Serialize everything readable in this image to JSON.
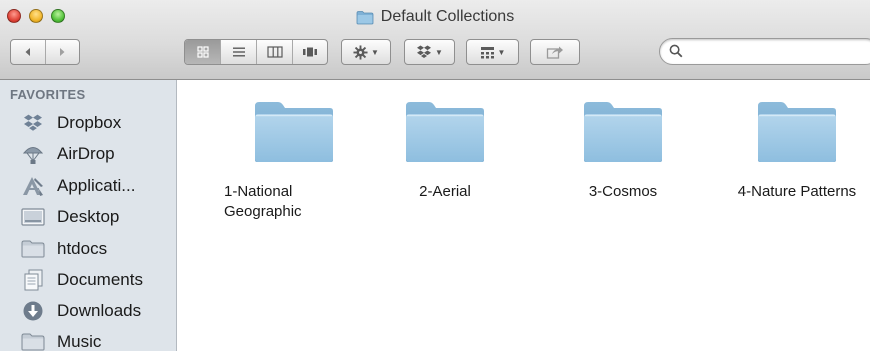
{
  "window": {
    "title": "Default Collections"
  },
  "sidebar": {
    "header": "FAVORITES",
    "items": [
      {
        "label": "Dropbox",
        "icon": "dropbox-icon"
      },
      {
        "label": "AirDrop",
        "icon": "airdrop-icon"
      },
      {
        "label": "Applicati...",
        "icon": "applications-icon"
      },
      {
        "label": "Desktop",
        "icon": "desktop-icon"
      },
      {
        "label": "htdocs",
        "icon": "folder-icon"
      },
      {
        "label": "Documents",
        "icon": "documents-icon"
      },
      {
        "label": "Downloads",
        "icon": "downloads-icon"
      },
      {
        "label": "Music",
        "icon": "folder-icon"
      }
    ]
  },
  "folders": [
    {
      "label_line1": "1-National",
      "label_line2": "Geographic"
    },
    {
      "label_line1": "2-Aerial",
      "label_line2": ""
    },
    {
      "label_line1": "3-Cosmos",
      "label_line2": ""
    },
    {
      "label_line1": "4-Nature Patterns",
      "label_line2": ""
    }
  ],
  "colors": {
    "folder_blue": "#8fbcd9",
    "sidebar_bg": "#dee4ea",
    "titlebar_top": "#ececec"
  }
}
